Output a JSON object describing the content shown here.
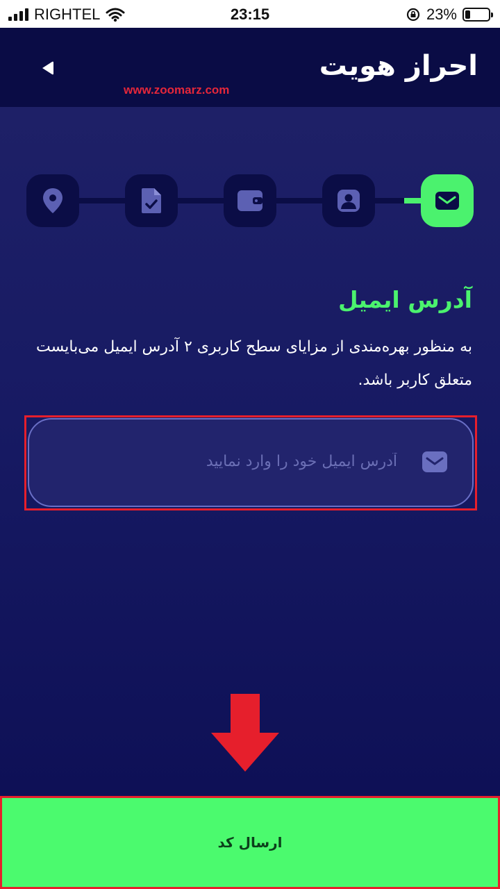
{
  "status_bar": {
    "carrier": "RIGHTEL",
    "time": "23:15",
    "battery_percent": "23%",
    "battery_level": 0.23
  },
  "header": {
    "title": "احراز هویت",
    "back_icon": "back-arrow-icon",
    "watermark": "www.zoomarz.com"
  },
  "stepper": {
    "steps": [
      {
        "icon": "email-icon",
        "active": true
      },
      {
        "icon": "id-card-icon",
        "active": false
      },
      {
        "icon": "wallet-icon",
        "active": false
      },
      {
        "icon": "document-check-icon",
        "active": false
      },
      {
        "icon": "location-pin-icon",
        "active": false
      }
    ]
  },
  "content": {
    "title": "آدرس ایمیل",
    "description": "به منظور بهره‌مندی از مزایای سطح کاربری ۲ آدرس ایمیل می‌بایست متعلق کاربر باشد."
  },
  "email_input": {
    "placeholder": "آدرس ایمیل خود را وارد نمایید",
    "value": "",
    "icon": "envelope-icon"
  },
  "submit": {
    "label": "ارسال کد"
  },
  "colors": {
    "background": "#0e1155",
    "accent": "#4bf26e",
    "step_inactive": "#0b0d46",
    "annotation_red": "#e61f2c"
  }
}
